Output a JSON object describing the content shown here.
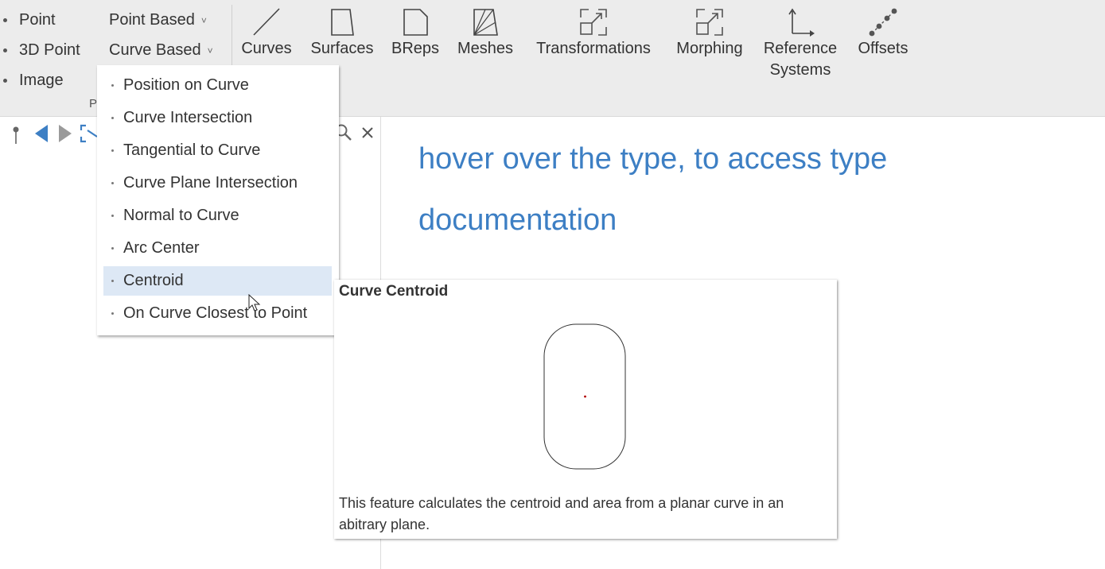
{
  "ribbon": {
    "left_items": [
      "Point",
      "3D Point",
      "Image"
    ],
    "point_based": "Point Based",
    "curve_based": "Curve Based",
    "group_caption": "P",
    "tools": {
      "curves": "Curves",
      "surfaces": "Surfaces",
      "breps": "BReps",
      "meshes": "Meshes",
      "transformations": "Transformations",
      "morphing": "Morphing",
      "reference_line1": "Reference",
      "reference_line2": "Systems",
      "offsets": "Offsets"
    }
  },
  "doc": {
    "heading": "hover over the type, to access type documentation"
  },
  "dropdown": {
    "items": [
      "Position on Curve",
      "Curve Intersection",
      "Tangential to Curve",
      "Curve Plane Intersection",
      "Normal to Curve",
      "Arc Center",
      "Centroid",
      "On Curve Closest to Point"
    ],
    "active_index": 6
  },
  "tooltip": {
    "title": "Curve Centroid",
    "description": "This feature calculates the centroid and area from a planar curve in an abitrary plane."
  },
  "colors": {
    "accent": "#3d7fc4",
    "active_bg": "#dde8f5",
    "ribbon_bg": "#ececec"
  }
}
